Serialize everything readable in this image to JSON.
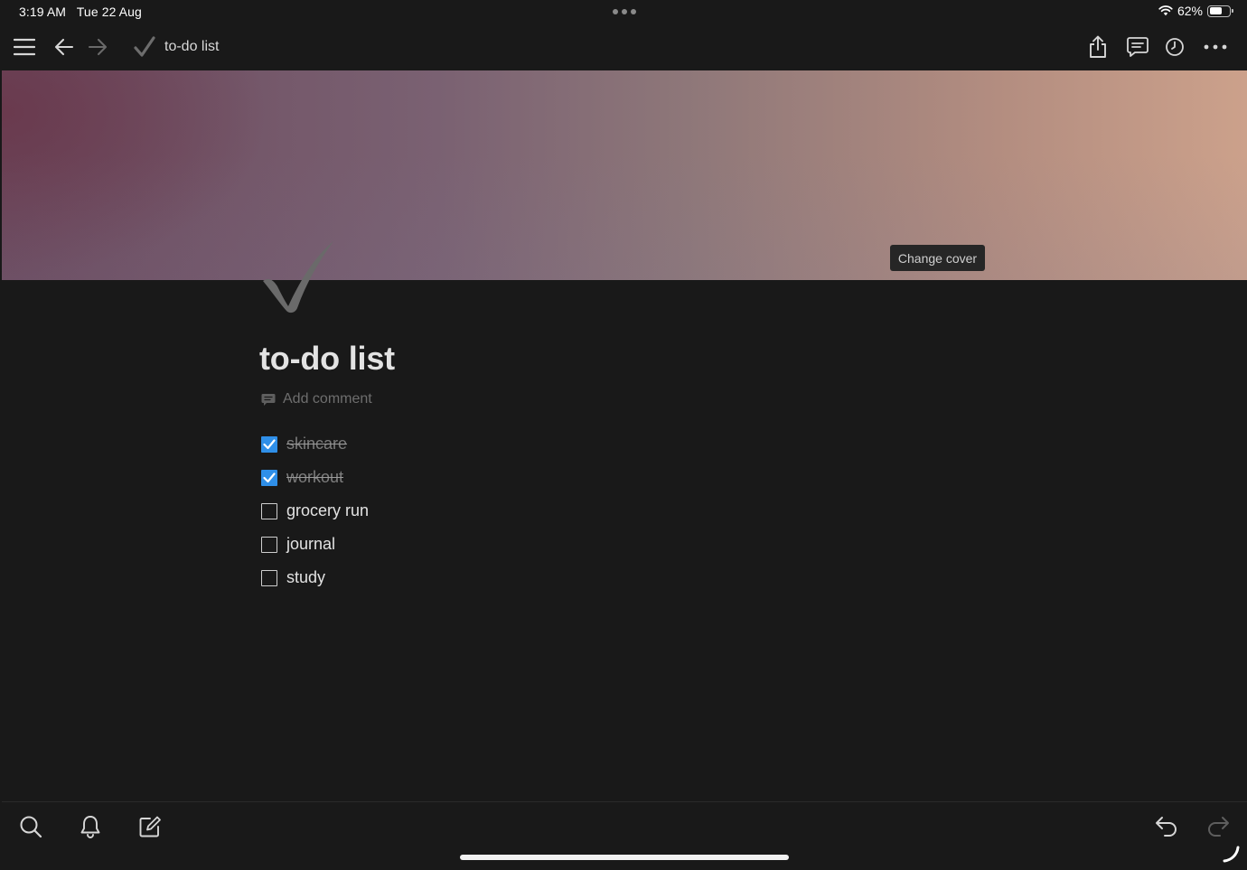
{
  "status_bar": {
    "time": "3:19 AM",
    "date": "Tue 22 Aug",
    "battery_percent": "62%",
    "battery_level": 0.62,
    "icons": [
      "wifi-icon",
      "battery-icon"
    ]
  },
  "top_bar": {
    "icons": [
      "menu-icon",
      "back-arrow-icon",
      "forward-arrow-icon",
      "checkmark-icon",
      "share-icon",
      "comments-icon",
      "history-icon",
      "more-icon"
    ],
    "breadcrumb_title": "to-do list"
  },
  "cover": {
    "change_cover_label": "Change cover",
    "colors": [
      "#6c4a5e",
      "#7a6172",
      "#8e7779",
      "#b38d80",
      "#cca18b"
    ]
  },
  "page": {
    "icon": "checkmark-icon",
    "title": "to-do list",
    "add_comment_label": "Add comment",
    "todos": [
      {
        "text": "skincare",
        "checked": true
      },
      {
        "text": "workout",
        "checked": true
      },
      {
        "text": "grocery run",
        "checked": false
      },
      {
        "text": "journal",
        "checked": false
      },
      {
        "text": "study",
        "checked": false
      }
    ]
  },
  "bottom_bar": {
    "icons": [
      "search-icon",
      "bell-icon",
      "compose-icon",
      "undo-icon",
      "redo-icon"
    ]
  },
  "colors": {
    "background": "#191919",
    "checkbox_checked": "#2f8fe8",
    "text_primary": "#e3e3e3",
    "text_muted": "#6e6e6e"
  }
}
